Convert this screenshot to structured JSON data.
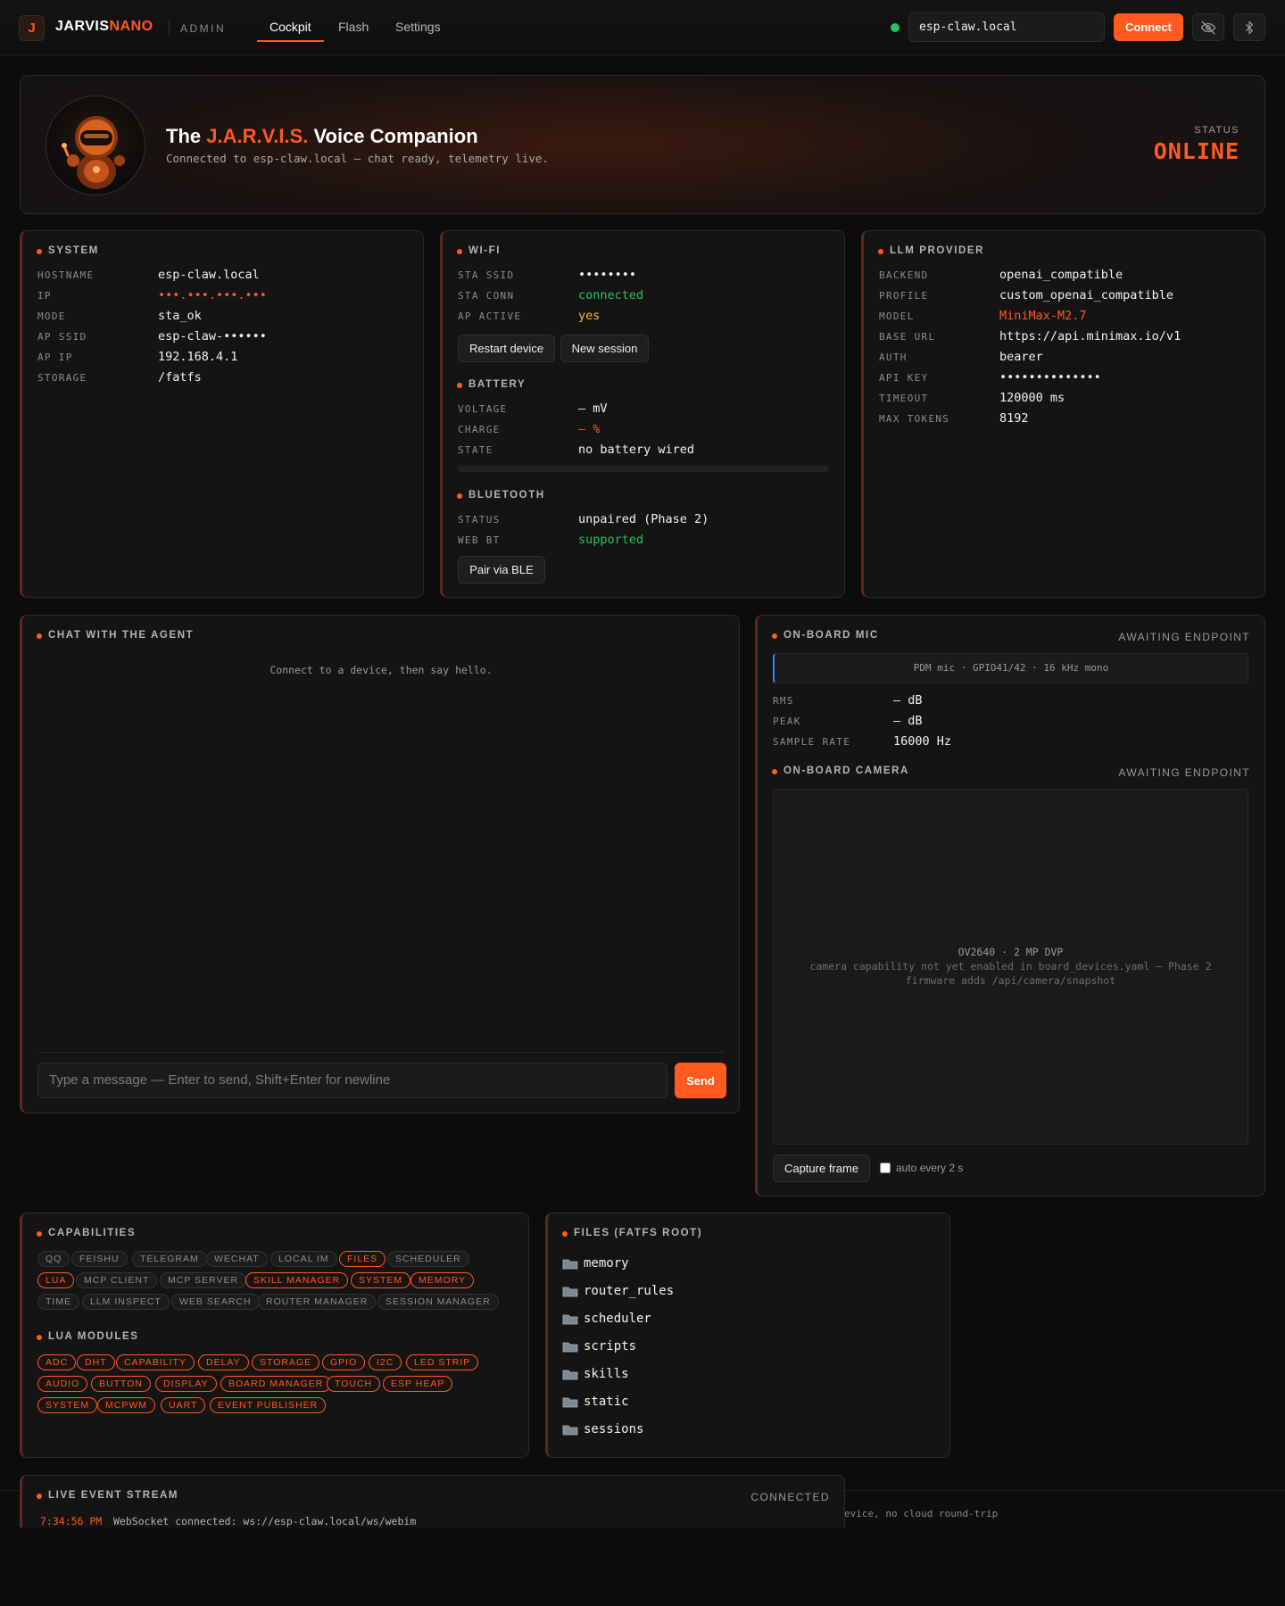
{
  "nav": {
    "logo_letter": "J",
    "brand_a": "JARVIS",
    "brand_b": "NANO",
    "admin": "ADMIN",
    "tabs": [
      {
        "label": "Cockpit",
        "active": true
      },
      {
        "label": "Flash",
        "active": false
      },
      {
        "label": "Settings",
        "active": false
      }
    ],
    "host_value": "esp-claw.local",
    "connect_label": "Connect",
    "icons": [
      "eye-off-icon",
      "bluetooth-icon"
    ],
    "connection_color": "#22c55e"
  },
  "hero": {
    "title_prefix": "The ",
    "title_accent": "J.A.R.V.I.S.",
    "title_suffix": " Voice Companion",
    "subtitle": "Connected to esp-claw.local — chat ready, telemetry live.",
    "status_label": "STATUS",
    "status_value": "ONLINE"
  },
  "system": {
    "title": "SYSTEM",
    "rows": [
      {
        "key": "HOSTNAME",
        "value": "esp-claw.local"
      },
      {
        "key": "IP",
        "value": "•••.•••.•••.•••"
      },
      {
        "key": "MODE",
        "value": "sta_ok"
      },
      {
        "key": "AP SSID",
        "value": "esp-claw-••••••"
      },
      {
        "key": "AP IP",
        "value": "192.168.4.1"
      },
      {
        "key": "STORAGE",
        "value": "/fatfs"
      }
    ]
  },
  "wifi": {
    "title": "WI-FI",
    "rows": [
      {
        "key": "STA SSID",
        "value": "••••••••"
      },
      {
        "key": "STA CONN",
        "value": "connected"
      },
      {
        "key": "AP ACTIVE",
        "value": "yes"
      }
    ],
    "restart_label": "Restart device",
    "new_session_label": "New session"
  },
  "battery": {
    "title": "BATTERY",
    "rows": [
      {
        "key": "VOLTAGE",
        "value": "— mV"
      },
      {
        "key": "CHARGE",
        "value": "— %"
      },
      {
        "key": "STATE",
        "value": "no battery wired"
      }
    ],
    "charge_fraction": 0
  },
  "bluetooth": {
    "title": "BLUETOOTH",
    "rows": [
      {
        "key": "STATUS",
        "value": "unpaired (Phase 2)"
      },
      {
        "key": "WEB BT",
        "value": "supported"
      }
    ],
    "pair_label": "Pair via BLE"
  },
  "llm": {
    "title": "LLM PROVIDER",
    "rows": [
      {
        "key": "BACKEND",
        "value": "openai_compatible"
      },
      {
        "key": "PROFILE",
        "value": "custom_openai_compatible"
      },
      {
        "key": "MODEL",
        "value": "MiniMax-M2.7"
      },
      {
        "key": "BASE URL",
        "value": "https://api.minimax.io/v1"
      },
      {
        "key": "AUTH",
        "value": "bearer"
      },
      {
        "key": "API KEY",
        "value": "••••••••••••••"
      },
      {
        "key": "TIMEOUT",
        "value": "120000 ms"
      },
      {
        "key": "MAX TOKENS",
        "value": "8192"
      }
    ]
  },
  "chat": {
    "title": "CHAT WITH THE AGENT",
    "empty_text": "Connect to a device, then say hello.",
    "input_placeholder": "Type a message — Enter to send, Shift+Enter for newline",
    "send_label": "Send"
  },
  "mic": {
    "title": "ON-BOARD MIC",
    "badge": "AWAITING ENDPOINT",
    "info": "PDM mic · GPIO41/42 · 16 kHz mono",
    "rows": [
      {
        "key": "RMS",
        "value": "— dB"
      },
      {
        "key": "PEAK",
        "value": "— dB"
      },
      {
        "key": "SAMPLE RATE",
        "value": "16000 Hz"
      }
    ]
  },
  "camera": {
    "title": "ON-BOARD CAMERA",
    "badge": "AWAITING ENDPOINT",
    "line1": "OV2640 · 2 MP DVP",
    "line2": "camera capability not yet enabled in board_devices.yaml — Phase 2",
    "line3": "firmware adds /api/camera/snapshot",
    "capture_label": "Capture frame",
    "auto_label": "auto every 2 s",
    "auto_checked": false
  },
  "capabilities": {
    "title": "CAPABILITIES",
    "chips": [
      {
        "label": "QQ",
        "on": false
      },
      {
        "label": "FEISHU",
        "on": false
      },
      {
        "label": "TELEGRAM",
        "on": false
      },
      {
        "label": "WECHAT",
        "on": false
      },
      {
        "label": "LOCAL IM",
        "on": false
      },
      {
        "label": "FILES",
        "on": true
      },
      {
        "label": "SCHEDULER",
        "on": false
      },
      {
        "label": "LUA",
        "on": true
      },
      {
        "label": "MCP CLIENT",
        "on": false
      },
      {
        "label": "MCP SERVER",
        "on": false
      },
      {
        "label": "SKILL MANAGER",
        "on": true
      },
      {
        "label": "SYSTEM",
        "on": true
      },
      {
        "label": "MEMORY",
        "on": true
      },
      {
        "label": "TIME",
        "on": false
      },
      {
        "label": "LLM INSPECT",
        "on": false
      },
      {
        "label": "WEB SEARCH",
        "on": false
      },
      {
        "label": "ROUTER MANAGER",
        "on": false
      },
      {
        "label": "SESSION MANAGER",
        "on": false
      }
    ]
  },
  "lua": {
    "title": "LUA MODULES",
    "chips": [
      "ADC",
      "DHT",
      "CAPABILITY",
      "DELAY",
      "STORAGE",
      "GPIO",
      "I2C",
      "LED STRIP",
      "AUDIO",
      "BUTTON",
      "DISPLAY",
      "BOARD MANAGER",
      "TOUCH",
      "ESP HEAP",
      "SYSTEM",
      "MCPWM",
      "UART",
      "EVENT PUBLISHER"
    ]
  },
  "files": {
    "title": "FILES (FATFS ROOT)",
    "items": [
      "memory",
      "router_rules",
      "scheduler",
      "scripts",
      "skills",
      "static",
      "sessions"
    ]
  },
  "events": {
    "title": "LIVE EVENT STREAM",
    "badge": "CONNECTED",
    "time": "7:34:56 PM",
    "message": "WebSocket connected: ws://esp-claw.local/ws/webim"
  },
  "footer": {
    "text": "evice, no cloud round-trip"
  },
  "colors": {
    "accent": "#ff5a1f",
    "ok": "#22c55e",
    "warn": "#f5b942"
  }
}
